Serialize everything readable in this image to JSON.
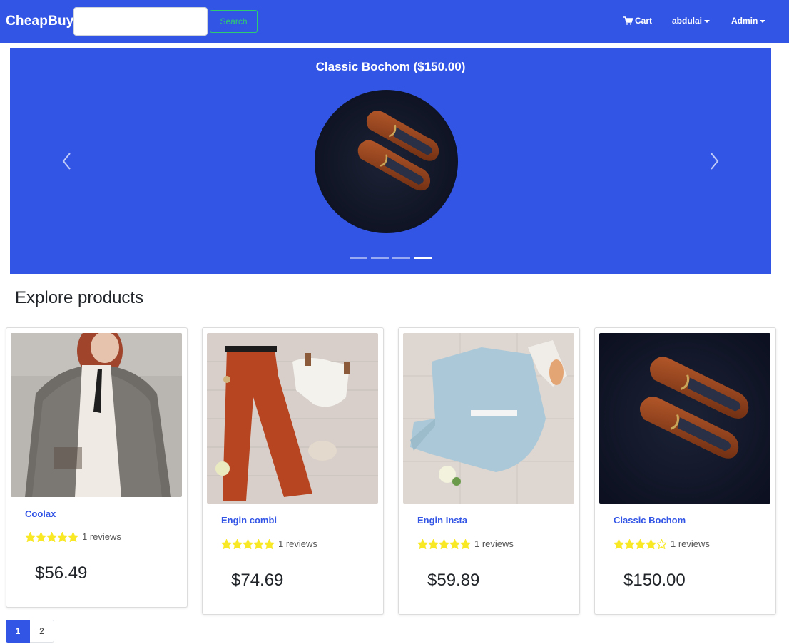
{
  "navbar": {
    "brand": "CheapBuy",
    "search_placeholder": "",
    "search_button": "Search",
    "cart_label": "Cart",
    "user_label": "abdulai",
    "admin_label": "Admin"
  },
  "carousel": {
    "caption": "Classic Bochom ($150.00)",
    "slide_count": 4,
    "active_slide": 4,
    "image": "brown-loafers-photo"
  },
  "explore": {
    "title": "Explore products"
  },
  "products": [
    {
      "name": "Coolax",
      "rating": 5,
      "reviews": "1 reviews",
      "price": "$56.49",
      "image": "woman-in-plaid-blazer-photo"
    },
    {
      "name": "Engin combi",
      "rating": 5,
      "reviews": "1 reviews",
      "price": "$74.69",
      "image": "orange-trousers-outfit-photo"
    },
    {
      "name": "Engin Insta",
      "rating": 5,
      "reviews": "1 reviews",
      "price": "$59.89",
      "image": "light-blue-shirt-outfit-photo"
    },
    {
      "name": "Classic Bochom",
      "rating": 4,
      "reviews": "1 reviews",
      "price": "$150.00",
      "image": "brown-loafers-photo"
    }
  ],
  "pagination": {
    "pages": [
      "1",
      "2"
    ],
    "active": "1"
  },
  "colors": {
    "primary": "#3355e6",
    "star": "#f8e825",
    "search_button": "#2ecc71"
  }
}
